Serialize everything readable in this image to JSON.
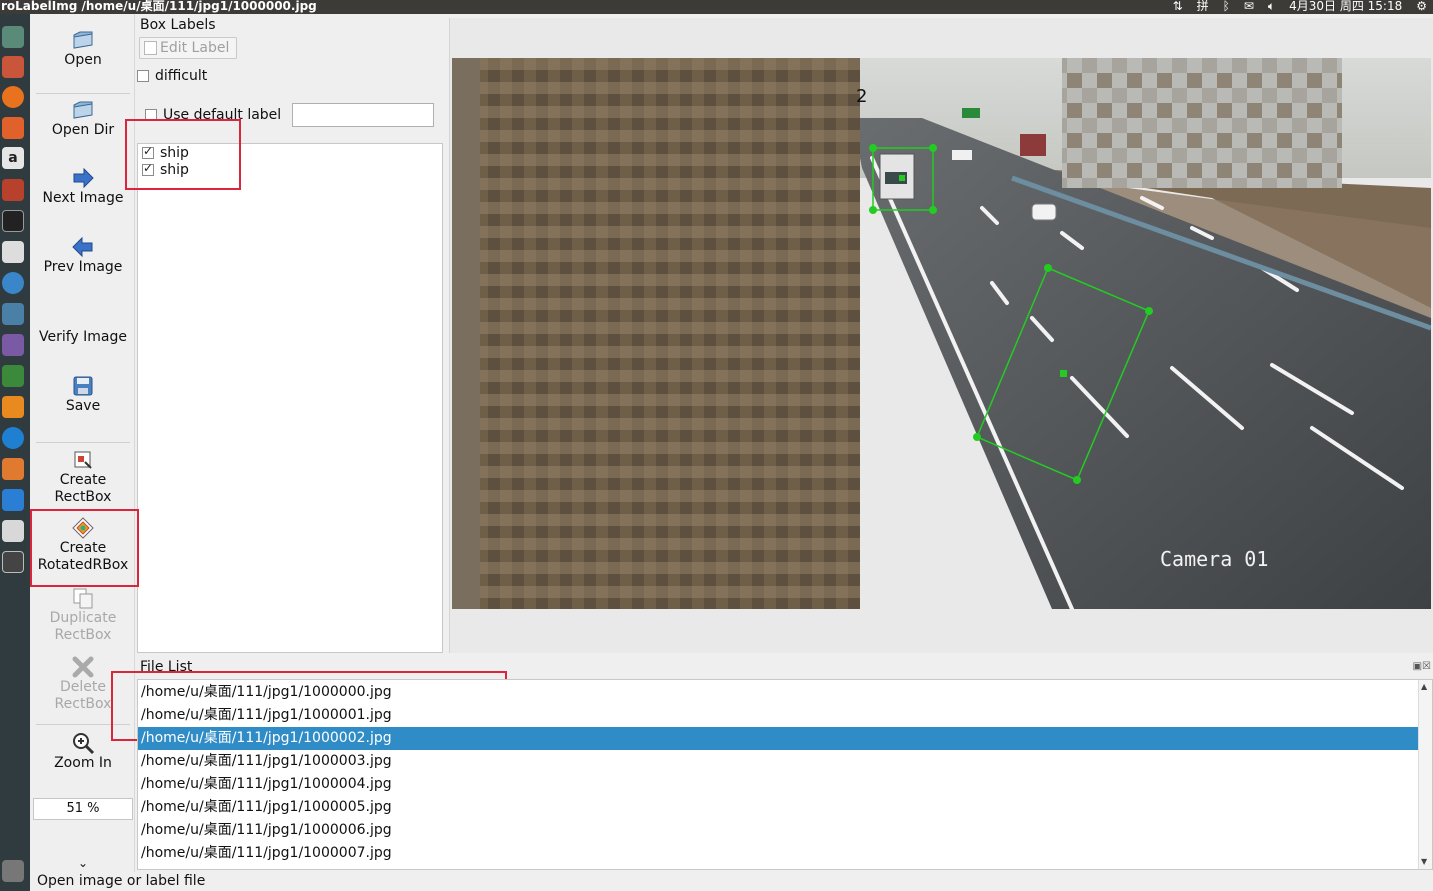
{
  "window_title": "roLabelImg /home/u/桌面/111/jpg1/1000000.jpg",
  "tray": {
    "clock": "4月30日 周四 15:18"
  },
  "toolbar": {
    "open": "Open",
    "open_dir": "Open Dir",
    "next_image": "Next Image",
    "prev_image": "Prev Image",
    "verify_image": "Verify Image",
    "save": "Save",
    "create_rectbox_1": "Create",
    "create_rectbox_2": "RectBox",
    "create_rotated_1": "Create",
    "create_rotated_2": "RotatedRBox",
    "duplicate_1": "Duplicate",
    "duplicate_2": "RectBox",
    "delete_1": "Delete",
    "delete_2": "RectBox",
    "zoom_in": "Zoom In",
    "zoom_value": "51 %",
    "more": "⌄"
  },
  "box_labels": {
    "title": "Box Labels",
    "edit_label": "Edit Label",
    "difficult": "difficult",
    "use_default_label": "Use default label",
    "default_label_value": "",
    "labels": [
      {
        "text": "ship",
        "checked": true
      },
      {
        "text": "ship",
        "checked": true
      }
    ]
  },
  "canvas": {
    "overlay_text": "Camera 01",
    "corner_digit": "2"
  },
  "file_list": {
    "title": "File List",
    "items": [
      "/home/u/桌面/111/jpg1/1000000.jpg",
      "/home/u/桌面/111/jpg1/1000001.jpg",
      "/home/u/桌面/111/jpg1/1000002.jpg",
      "/home/u/桌面/111/jpg1/1000003.jpg",
      "/home/u/桌面/111/jpg1/1000004.jpg",
      "/home/u/桌面/111/jpg1/1000005.jpg",
      "/home/u/桌面/111/jpg1/1000006.jpg",
      "/home/u/桌面/111/jpg1/1000007.jpg"
    ],
    "selected_index": 2
  },
  "status": "Open image or label file",
  "colors": {
    "selection": "#308cc6",
    "highlight": "#d9263e",
    "shape": "#22cc22"
  }
}
